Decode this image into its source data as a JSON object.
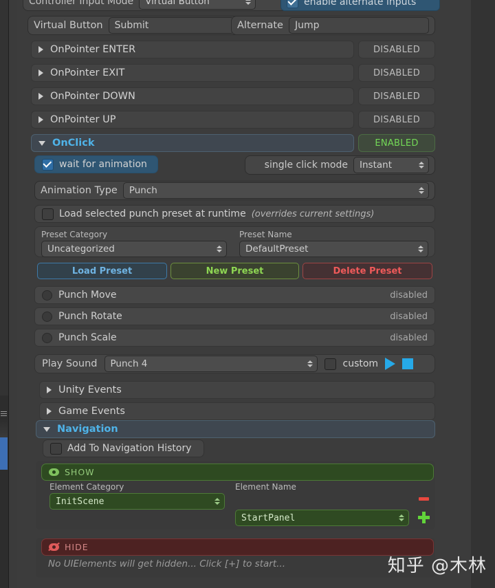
{
  "top": {
    "controller_input_mode_label": "Controller Input Mode",
    "controller_input_mode_value": "Virtual Button",
    "enable_alternate_label": "enable alternate inputs",
    "virtual_button_label": "Virtual Button",
    "virtual_button_value": "Submit",
    "alternate_label": "Alternate",
    "alternate_value": "Jump"
  },
  "events": [
    {
      "name": "OnPointer ENTER",
      "status": "DISABLED",
      "expanded": false
    },
    {
      "name": "OnPointer EXIT",
      "status": "DISABLED",
      "expanded": false
    },
    {
      "name": "OnPointer DOWN",
      "status": "DISABLED",
      "expanded": false
    },
    {
      "name": "OnPointer UP",
      "status": "DISABLED",
      "expanded": false
    },
    {
      "name": "OnClick",
      "status": "ENABLED",
      "expanded": true
    }
  ],
  "onclick": {
    "wait_for_animation_label": "wait for animation",
    "wait_for_animation_checked": true,
    "single_click_mode_label": "single click mode",
    "single_click_mode_value": "Instant",
    "animation_type_label": "Animation Type",
    "animation_type_value": "Punch",
    "load_preset_runtime_label": "Load selected punch preset at runtime",
    "load_preset_runtime_hint": "(overrides current settings)",
    "load_preset_runtime_checked": false,
    "preset_category_label": "Preset Category",
    "preset_category_value": "Uncategorized",
    "preset_name_label": "Preset Name",
    "preset_name_value": "DefaultPreset",
    "buttons": {
      "load": "Load Preset",
      "new": "New Preset",
      "delete": "Delete Preset"
    },
    "punch_rows": [
      {
        "name": "Punch Move",
        "state": "disabled"
      },
      {
        "name": "Punch Rotate",
        "state": "disabled"
      },
      {
        "name": "Punch Scale",
        "state": "disabled"
      }
    ],
    "play_sound_label": "Play Sound",
    "play_sound_value": "Punch 4",
    "custom_label": "custom",
    "custom_checked": false
  },
  "sections": [
    {
      "name": "Unity Events",
      "expanded": false
    },
    {
      "name": "Game Events",
      "expanded": false
    },
    {
      "name": "Navigation",
      "expanded": true
    }
  ],
  "navigation": {
    "add_to_history_label": "Add To Navigation History",
    "add_to_history_checked": false,
    "show_label": "SHOW",
    "element_category_label": "Element Category",
    "element_category_value": "InitScene",
    "element_name_label": "Element Name",
    "element_name_value": "StartPanel",
    "hide_label": "HIDE",
    "hide_empty_text": "No UIElements will get hidden... Click [+] to start..."
  },
  "watermark": "知乎 @木林",
  "colors": {
    "accent_blue": "#4fb3e8",
    "enabled_green": "#74d957",
    "show_green": "#4c7a36",
    "hide_red": "#7a3535",
    "play_blue": "#26a9e8",
    "selection_blue": "#3d6fb5"
  }
}
